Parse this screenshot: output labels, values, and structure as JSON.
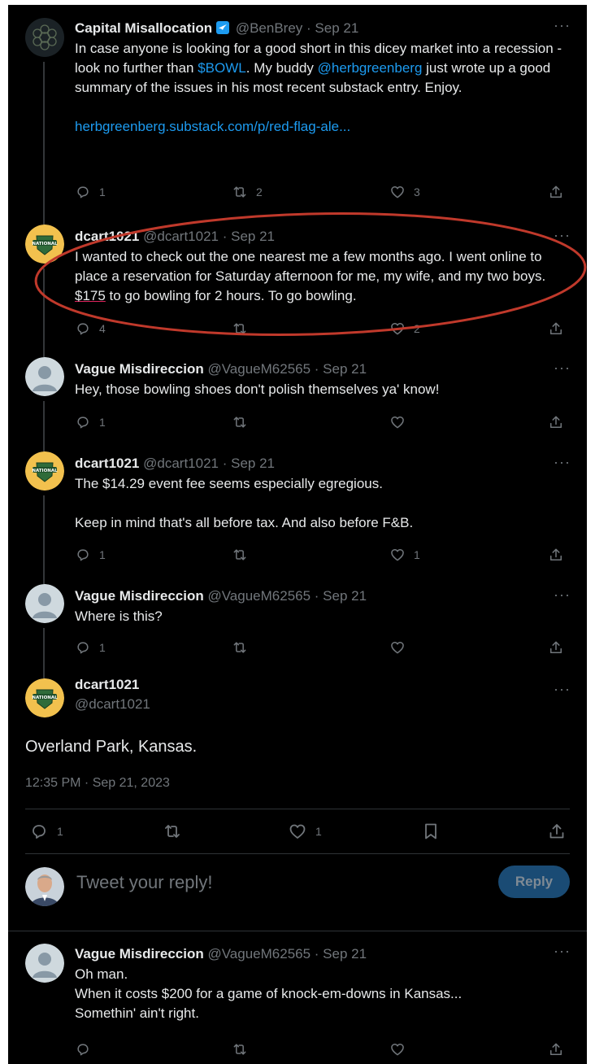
{
  "colors": {
    "background": "#000000",
    "text": "#e7e9ea",
    "muted": "#71767b",
    "link": "#1d9bf0",
    "verified": "#1d9bf0",
    "reply_button": "#1a4b74",
    "annotation": "#c0392b"
  },
  "tweets": [
    {
      "name": "Capital Misallocation",
      "handle": "@BenBrey",
      "date": "· Sep 21",
      "verified_icon": "verified-badge-icon",
      "text_parts": {
        "a": "In case anyone is looking for a good short in this dicey market into a recession - look no further than ",
        "cashtag": "$BOWL",
        "b": ". My buddy ",
        "mention": "@herbgreenberg",
        "c": " just wrote up a good summary of the issues in his most recent substack entry. Enjoy.",
        "link": "herbgreenberg.substack.com/p/red-flag-ale..."
      },
      "replies": "1",
      "retweets": "2",
      "likes": "3"
    },
    {
      "name": "dcart1021",
      "handle": "@dcart1021",
      "date": "· Sep 21",
      "text_parts": {
        "a": "I wanted to check out the one nearest me a few months ago.  I went online to place a reservation for Saturday afternoon for me, my wife, and my two boys.  ",
        "price": "$175",
        "b": " to go bowling for 2 hours.  To go bowling."
      },
      "replies": "4",
      "retweets": "",
      "likes": "2"
    },
    {
      "name": "Vague Misdireccion",
      "handle": "@VagueM62565",
      "date": "· Sep 21",
      "text": "Hey, those bowling shoes don't polish themselves ya' know!",
      "replies": "1",
      "retweets": "",
      "likes": ""
    },
    {
      "name": "dcart1021",
      "handle": "@dcart1021",
      "date": "· Sep 21",
      "line1": "The $14.29 event fee seems especially egregious.",
      "line2": "Keep in mind that's all before tax.  And also before F&B.",
      "replies": "1",
      "retweets": "",
      "likes": "1"
    },
    {
      "name": "Vague Misdireccion",
      "handle": "@VagueM62565",
      "date": "· Sep 21",
      "text": "Where is this?",
      "replies": "1",
      "retweets": "",
      "likes": ""
    }
  ],
  "main_tweet": {
    "name": "dcart1021",
    "handle": "@dcart1021",
    "text": "Overland Park, Kansas.",
    "timestamp": "12:35 PM · Sep 21, 2023",
    "replies": "1",
    "likes": "1"
  },
  "reply_box": {
    "placeholder": "Tweet your reply!",
    "button": "Reply"
  },
  "last_reply": {
    "name": "Vague Misdireccion",
    "handle": "@VagueM62565",
    "date": "· Sep 21",
    "line1": "Oh man.",
    "line2": "When it costs $200 for  a game of knock-em-downs in Kansas...",
    "line3": "Somethin' ain't right."
  },
  "more_label": "···"
}
